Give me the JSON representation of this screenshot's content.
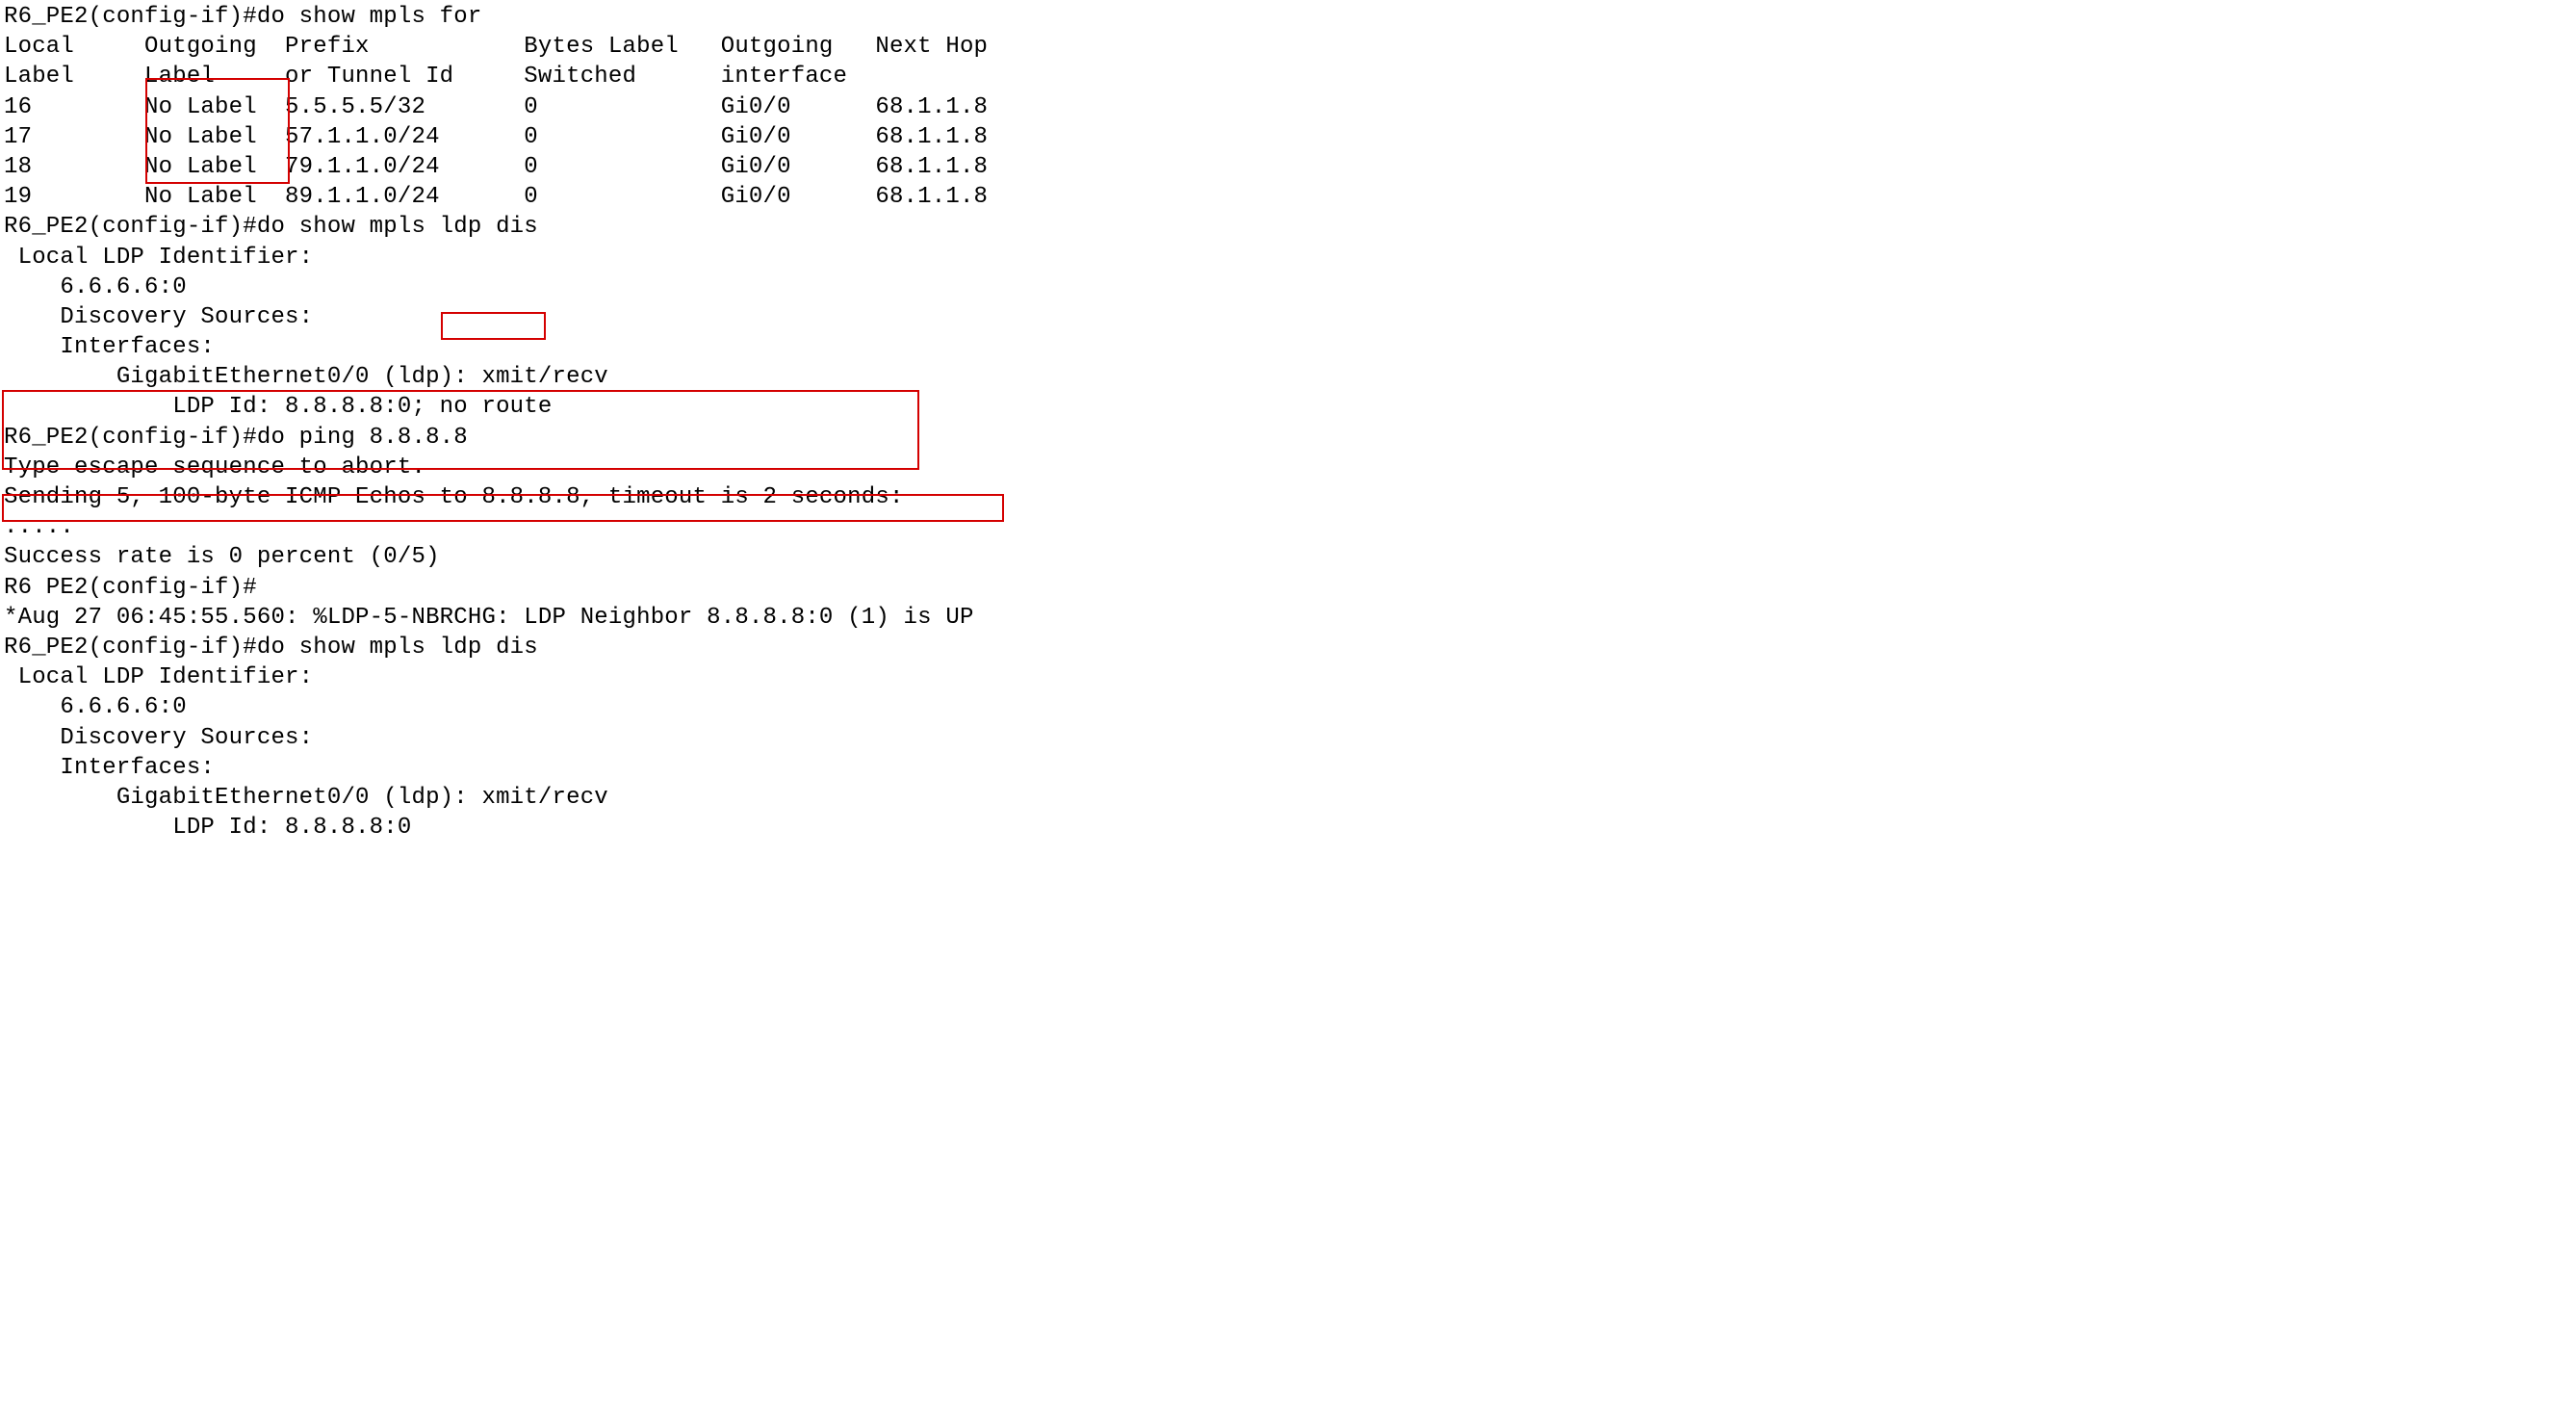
{
  "prompt": "R6_PE2(config-if)#",
  "prompt_space": "R6 PE2(config-if)#",
  "commands": {
    "show_mpls_for": "do show mpls for",
    "show_mpls_ldp_dis": "do show mpls ldp dis",
    "ping": "do ping 8.8.8.8"
  },
  "mpls_for_table": {
    "header_row1": {
      "local": "Local",
      "outgoing": "Outgoing",
      "prefix": "Prefix",
      "bytes": "Bytes Label",
      "intf": "Outgoing",
      "nexthop": "Next Hop"
    },
    "header_row2": {
      "local": "Label",
      "outgoing": "Label",
      "prefix": "or Tunnel Id",
      "bytes": "Switched",
      "intf": "interface",
      "nexthop": ""
    },
    "rows": [
      {
        "local": "16",
        "outgoing": "No Label",
        "prefix": "5.5.5.5/32",
        "bytes": "0",
        "intf": "Gi0/0",
        "nexthop": "68.1.1.8"
      },
      {
        "local": "17",
        "outgoing": "No Label",
        "prefix": "57.1.1.0/24",
        "bytes": "0",
        "intf": "Gi0/0",
        "nexthop": "68.1.1.8"
      },
      {
        "local": "18",
        "outgoing": "No Label",
        "prefix": "79.1.1.0/24",
        "bytes": "0",
        "intf": "Gi0/0",
        "nexthop": "68.1.1.8"
      },
      {
        "local": "19",
        "outgoing": "No Label",
        "prefix": "89.1.1.0/24",
        "bytes": "0",
        "intf": "Gi0/0",
        "nexthop": "68.1.1.8"
      }
    ]
  },
  "ldp_dis_1": {
    "header": " Local LDP Identifier:",
    "id": "    6.6.6.6:0",
    "sources": "    Discovery Sources:",
    "interfaces": "    Interfaces:",
    "ge": "        GigabitEthernet0/0 (ldp): xmit/recv",
    "ldp_id_prefix": "            LDP Id: 8.8.8.8:0; ",
    "no_route": "no route"
  },
  "ping_output": {
    "abort": "Type escape sequence to abort.",
    "sending": "Sending 5, 100-byte ICMP Echos to 8.8.8.8, timeout is 2 seconds:",
    "dots": ".....",
    "success": "Success rate is 0 percent (0/5)"
  },
  "log_msg": "*Aug 27 06:45:55.560: %LDP-5-NBRCHG: LDP Neighbor 8.8.8.8:0 (1) is UP",
  "ldp_dis_2": {
    "header": " Local LDP Identifier:",
    "id": "    6.6.6.6:0",
    "sources": "    Discovery Sources:",
    "interfaces": "    Interfaces:",
    "ge": "        GigabitEthernet0/0 (ldp): xmit/recv",
    "ldp_id": "            LDP Id: 8.8.8.8:0"
  },
  "highlight_boxes": {
    "no_label_col": {
      "top_line": 3,
      "height_lines": 4,
      "left_ch": 10.2,
      "width_ch": 10
    },
    "no_route": {
      "top_line": 12,
      "height_lines": 1,
      "left_ch": 31.2,
      "width_ch": 7.2
    },
    "ping_block": {
      "top_line": 15,
      "height_lines": 3,
      "left_ch": 0,
      "width_ch": 65
    },
    "log_line": {
      "top_line": 19,
      "height_lines": 1,
      "left_ch": 0,
      "width_ch": 71
    }
  },
  "colors": {
    "highlight": "#d40000",
    "text": "#000000",
    "bg": "#ffffff"
  }
}
